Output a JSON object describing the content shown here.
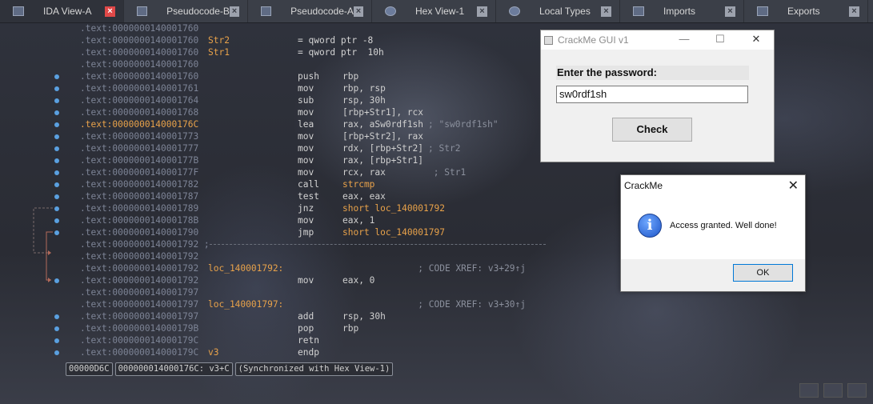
{
  "tabs": [
    {
      "label": "IDA View-A",
      "active": true,
      "icon": "ida-view-icon"
    },
    {
      "label": "Pseudocode-B",
      "active": false,
      "icon": "pseudocode-icon"
    },
    {
      "label": "Pseudocode-A",
      "active": false,
      "icon": "pseudocode-icon"
    },
    {
      "label": "Hex View-1",
      "active": false,
      "icon": "hex-view-icon"
    },
    {
      "label": "Local Types",
      "active": false,
      "icon": "local-types-icon"
    },
    {
      "label": "Imports",
      "active": false,
      "icon": "imports-icon"
    },
    {
      "label": "Exports",
      "active": false,
      "icon": "exports-icon"
    }
  ],
  "close_glyph": "×",
  "listing": [
    {
      "addr": ".text:0000000140001760",
      "label": "",
      "mn": "",
      "op": "",
      "cm": ""
    },
    {
      "addr": ".text:0000000140001760",
      "label": "Str2",
      "mn": "= qword ptr -8",
      "op": "",
      "cm": ""
    },
    {
      "addr": ".text:0000000140001760",
      "label": "Str1",
      "mn": "= qword ptr  10h",
      "op": "",
      "cm": ""
    },
    {
      "addr": ".text:0000000140001760",
      "label": "",
      "mn": "",
      "op": "",
      "cm": ""
    },
    {
      "addr": ".text:0000000140001760",
      "label": "",
      "mn": "push",
      "op": "rbp",
      "cm": ""
    },
    {
      "addr": ".text:0000000140001761",
      "label": "",
      "mn": "mov",
      "op": "rbp, rsp",
      "cm": ""
    },
    {
      "addr": ".text:0000000140001764",
      "label": "",
      "mn": "sub",
      "op": "rsp, 30h",
      "cm": ""
    },
    {
      "addr": ".text:0000000140001768",
      "label": "",
      "mn": "mov",
      "op": "[rbp+Str1], rcx",
      "cm": ""
    },
    {
      "addr": ".text:000000014000176C",
      "label": "",
      "mn": "lea",
      "op": "rax, aSw0rdf1sh",
      "cm": "; \"sw0rdf1sh\"",
      "hl": true
    },
    {
      "addr": ".text:0000000140001773",
      "label": "",
      "mn": "mov",
      "op": "[rbp+Str2], rax",
      "cm": ""
    },
    {
      "addr": ".text:0000000140001777",
      "label": "",
      "mn": "mov",
      "op": "rdx, [rbp+Str2]",
      "cm": "; Str2"
    },
    {
      "addr": ".text:000000014000177B",
      "label": "",
      "mn": "mov",
      "op": "rax, [rbp+Str1]",
      "cm": ""
    },
    {
      "addr": ".text:000000014000177F",
      "label": "",
      "mn": "mov",
      "op": "rcx, rax",
      "cm": "        ; Str1"
    },
    {
      "addr": ".text:0000000140001782",
      "label": "",
      "mn": "call",
      "op": "strcmp",
      "cm": ""
    },
    {
      "addr": ".text:0000000140001787",
      "label": "",
      "mn": "test",
      "op": "eax, eax",
      "cm": ""
    },
    {
      "addr": ".text:0000000140001789",
      "label": "",
      "mn": "jnz",
      "op": "short loc_140001792",
      "cm": ""
    },
    {
      "addr": ".text:000000014000178B",
      "label": "",
      "mn": "mov",
      "op": "eax, 1",
      "cm": ""
    },
    {
      "addr": ".text:0000000140001790",
      "label": "",
      "mn": "jmp",
      "op": "short loc_140001797",
      "cm": ""
    },
    {
      "addr": ".text:0000000140001792 ;",
      "label": "",
      "mn": "",
      "op": "",
      "cm": "",
      "sep": true
    },
    {
      "addr": ".text:0000000140001792",
      "label": "",
      "mn": "",
      "op": "",
      "cm": ""
    },
    {
      "addr": ".text:0000000140001792",
      "label": "loc_140001792:",
      "mn": "",
      "op": "",
      "cm": "              ; CODE XREF: v3+29↑j"
    },
    {
      "addr": ".text:0000000140001792",
      "label": "",
      "mn": "mov",
      "op": "eax, 0",
      "cm": ""
    },
    {
      "addr": ".text:0000000140001797",
      "label": "",
      "mn": "",
      "op": "",
      "cm": ""
    },
    {
      "addr": ".text:0000000140001797",
      "label": "loc_140001797:",
      "mn": "",
      "op": "",
      "cm": "              ; CODE XREF: v3+30↑j"
    },
    {
      "addr": ".text:0000000140001797",
      "label": "",
      "mn": "add",
      "op": "rsp, 30h",
      "cm": ""
    },
    {
      "addr": ".text:000000014000179B",
      "label": "",
      "mn": "pop",
      "op": "rbp",
      "cm": ""
    },
    {
      "addr": ".text:000000014000179C",
      "label": "",
      "mn": "retn",
      "op": "",
      "cm": ""
    },
    {
      "addr": ".text:000000014000179C",
      "label": "v3",
      "mn": "endp",
      "op": "",
      "cm": ""
    }
  ],
  "statusbar": {
    "offset": "00000D6C",
    "location": "000000014000176C: v3+C",
    "sync": "(Synchronized with Hex View-1)"
  },
  "crackme_window": {
    "title": "CrackMe GUI v1",
    "prompt": "Enter the password:",
    "password_value": "sw0rdf1sh",
    "check_label": "Check",
    "min_glyph": "—",
    "max_glyph": "☐",
    "close_glyph": "✕"
  },
  "message_box": {
    "title": "CrackMe",
    "message": "Access granted. Well done!",
    "ok_label": "OK",
    "info_glyph": "i",
    "close_glyph": "✕"
  },
  "colors": {
    "background": "#2b2d35",
    "address": "#7d8496",
    "highlight": "#e8a24a",
    "active_close": "#e04848"
  }
}
